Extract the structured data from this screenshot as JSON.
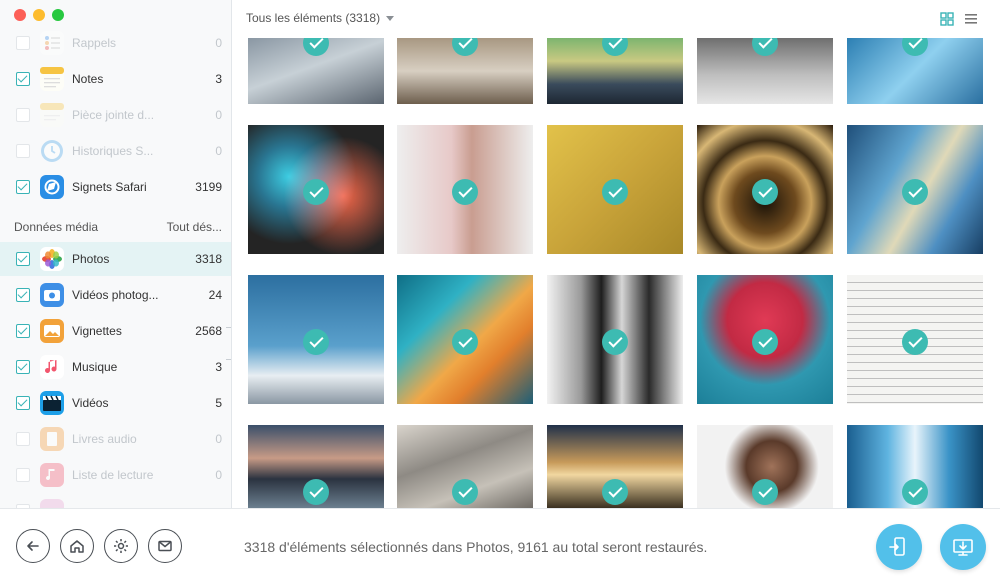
{
  "window": {
    "controls": [
      "close",
      "minimize",
      "zoom"
    ]
  },
  "sidebar": {
    "items_top": [
      {
        "label": "Rappels",
        "count": "0",
        "checked": false,
        "dim": true,
        "icon": "reminders-icon"
      },
      {
        "label": "Notes",
        "count": "3",
        "checked": true,
        "dim": false,
        "icon": "notes-icon"
      },
      {
        "label": "Pièce jointe d...",
        "count": "0",
        "checked": false,
        "dim": true,
        "icon": "attachment-icon"
      },
      {
        "label": "Historiques S...",
        "count": "0",
        "checked": false,
        "dim": true,
        "icon": "history-icon"
      },
      {
        "label": "Signets Safari",
        "count": "3199",
        "checked": true,
        "dim": false,
        "icon": "safari-bookmarks-icon"
      }
    ],
    "section": {
      "title": "Données média",
      "action": "Tout dés..."
    },
    "items_media": [
      {
        "label": "Photos",
        "count": "3318",
        "checked": true,
        "dim": false,
        "selected": true,
        "icon": "photos-icon"
      },
      {
        "label": "Vidéos photog...",
        "count": "24",
        "checked": true,
        "dim": false,
        "icon": "photo-videos-icon"
      },
      {
        "label": "Vignettes",
        "count": "2568",
        "checked": true,
        "dim": false,
        "icon": "thumbnails-icon"
      },
      {
        "label": "Musique",
        "count": "3",
        "checked": true,
        "dim": false,
        "icon": "music-icon"
      },
      {
        "label": "Vidéos",
        "count": "5",
        "checked": true,
        "dim": false,
        "icon": "videos-icon"
      },
      {
        "label": "Livres audio",
        "count": "0",
        "checked": false,
        "dim": true,
        "icon": "audiobooks-icon"
      },
      {
        "label": "Liste de lecture",
        "count": "0",
        "checked": false,
        "dim": true,
        "icon": "playlist-icon"
      }
    ]
  },
  "topbar": {
    "filter_label": "Tous les éléments (3318)",
    "view_modes": [
      "grid-view-icon",
      "list-view-icon"
    ]
  },
  "photos": [
    {
      "desc": "dog-by-sea",
      "checked": true
    },
    {
      "desc": "pampas-vase",
      "checked": true
    },
    {
      "desc": "aurora-landscape",
      "checked": true
    },
    {
      "desc": "ceramic-vases",
      "checked": true
    },
    {
      "desc": "blue-abstract",
      "checked": true
    },
    {
      "desc": "paint-splash",
      "checked": true
    },
    {
      "desc": "feather-pink",
      "checked": true
    },
    {
      "desc": "gold-texture",
      "checked": true
    },
    {
      "desc": "spiral-staircase",
      "checked": true
    },
    {
      "desc": "blue-feathers",
      "checked": true
    },
    {
      "desc": "mountain-sky",
      "checked": true
    },
    {
      "desc": "aerial-coast",
      "checked": true
    },
    {
      "desc": "penguins",
      "checked": true
    },
    {
      "desc": "raspberries-bowl",
      "checked": true
    },
    {
      "desc": "handwritten-notes",
      "checked": true
    },
    {
      "desc": "lake-sunset",
      "checked": true
    },
    {
      "desc": "bedsheets",
      "checked": true
    },
    {
      "desc": "city-night",
      "checked": true
    },
    {
      "desc": "woman-smiling",
      "checked": true
    },
    {
      "desc": "blue-fabric",
      "checked": true
    }
  ],
  "footer": {
    "buttons": [
      "back-icon",
      "home-icon",
      "settings-icon",
      "mail-icon"
    ],
    "status": "3318 d'éléments sélectionnés dans Photos, 9161 au total seront restaurés.",
    "actions": [
      "restore-to-device-icon",
      "restore-to-computer-icon"
    ]
  },
  "colors": {
    "accent": "#3dbbb2",
    "button": "#52c0ea",
    "selected_bg": "#e4f3f4"
  }
}
